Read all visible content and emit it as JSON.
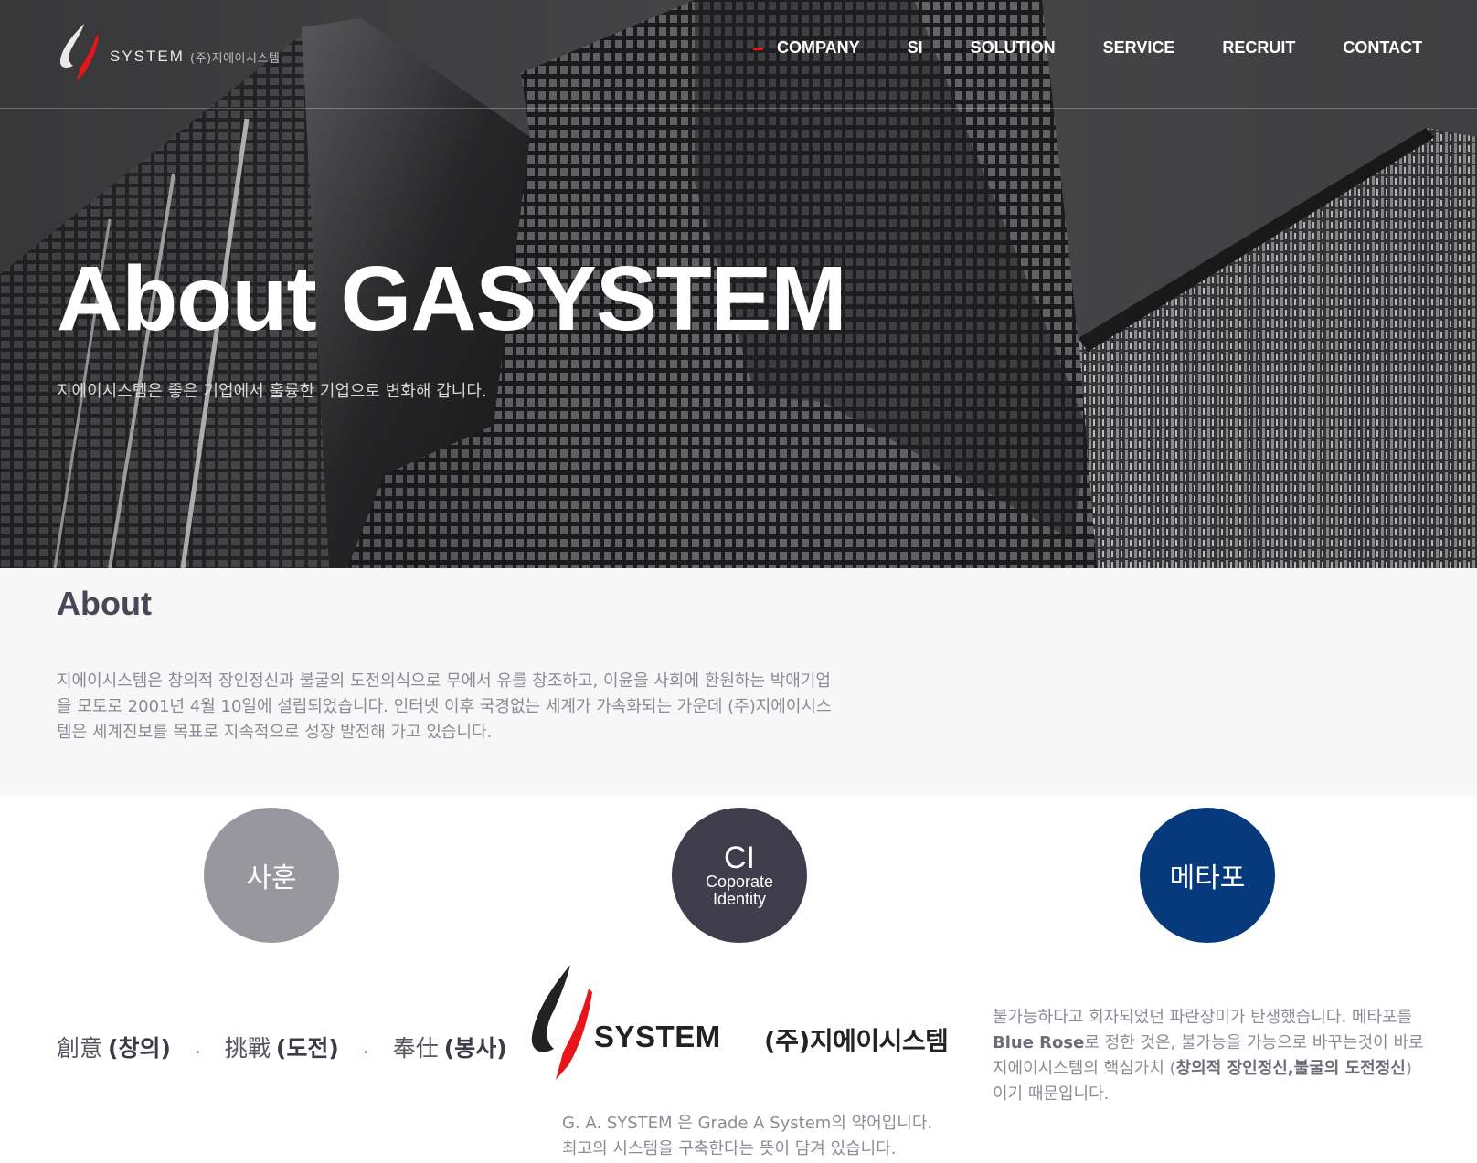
{
  "header": {
    "logo": {
      "wordmark": "SYSTEM",
      "korean": "(주)지에이시스템"
    },
    "nav": [
      {
        "label": "COMPANY",
        "active": true
      },
      {
        "label": "SI",
        "active": false
      },
      {
        "label": "SOLUTION",
        "active": false
      },
      {
        "label": "SERVICE",
        "active": false
      },
      {
        "label": "RECRUIT",
        "active": false
      },
      {
        "label": "CONTACT",
        "active": false
      }
    ]
  },
  "hero": {
    "title": "About GASYSTEM",
    "subtitle": "지에이시스템은 좋은 기업에서 훌륭한 기업으로 변화해 갑니다."
  },
  "about": {
    "heading": "About",
    "text": "지에이시스템은 창의적 장인정신과 불굴의 도전의식으로 무에서 유를 창조하고, 이윤을 사회에 환원하는 박애기업을 모토로 2001년 4월 10일에 설립되었습니다. 인터넷 이후 국경없는 세계가 가속화되는 가운데 (주)지에이시스템은 세계진보를 목표로 지속적으로 성장 발전해 가고 있습니다."
  },
  "values": {
    "circle1": {
      "label": "사훈"
    },
    "circle2": {
      "title": "CI",
      "line1": "Coporate",
      "line2": "Identity"
    },
    "circle3": {
      "label": "메타포"
    },
    "motto": [
      {
        "hanja": "創意",
        "korean": "(창의)"
      },
      {
        "hanja": "挑戰",
        "korean": "(도전)"
      },
      {
        "hanja": "奉仕",
        "korean": "(봉사)"
      }
    ],
    "motto_separator": ".",
    "ci_logo": {
      "wordmark": "SYSTEM",
      "korean": "(주)지에이시스템"
    },
    "ci_caption": {
      "line1": "G. A. SYSTEM 은 Grade A System의 약어입니다.",
      "line2": "최고의 시스템을 구축한다는 뜻이 담겨 있습니다."
    },
    "metaphor": {
      "part1": "불가능하다고 회자되었던 파란장미가 탄생했습니다. 메타포를 ",
      "bold1": "Blue Rose",
      "part2": "로 정한 것은, 불가능을 가능으로 바꾸는것이 바로 지에이시스템의 핵심가치 (",
      "bold2": "창의적 장인정신,불굴의 도전정신",
      "part3": ") 이기 때문입니다."
    }
  },
  "colors": {
    "accent_red": "#e8141c",
    "circle_grey": "#98979f",
    "circle_dark": "#3f3d4c",
    "circle_blue": "#073a7c"
  }
}
